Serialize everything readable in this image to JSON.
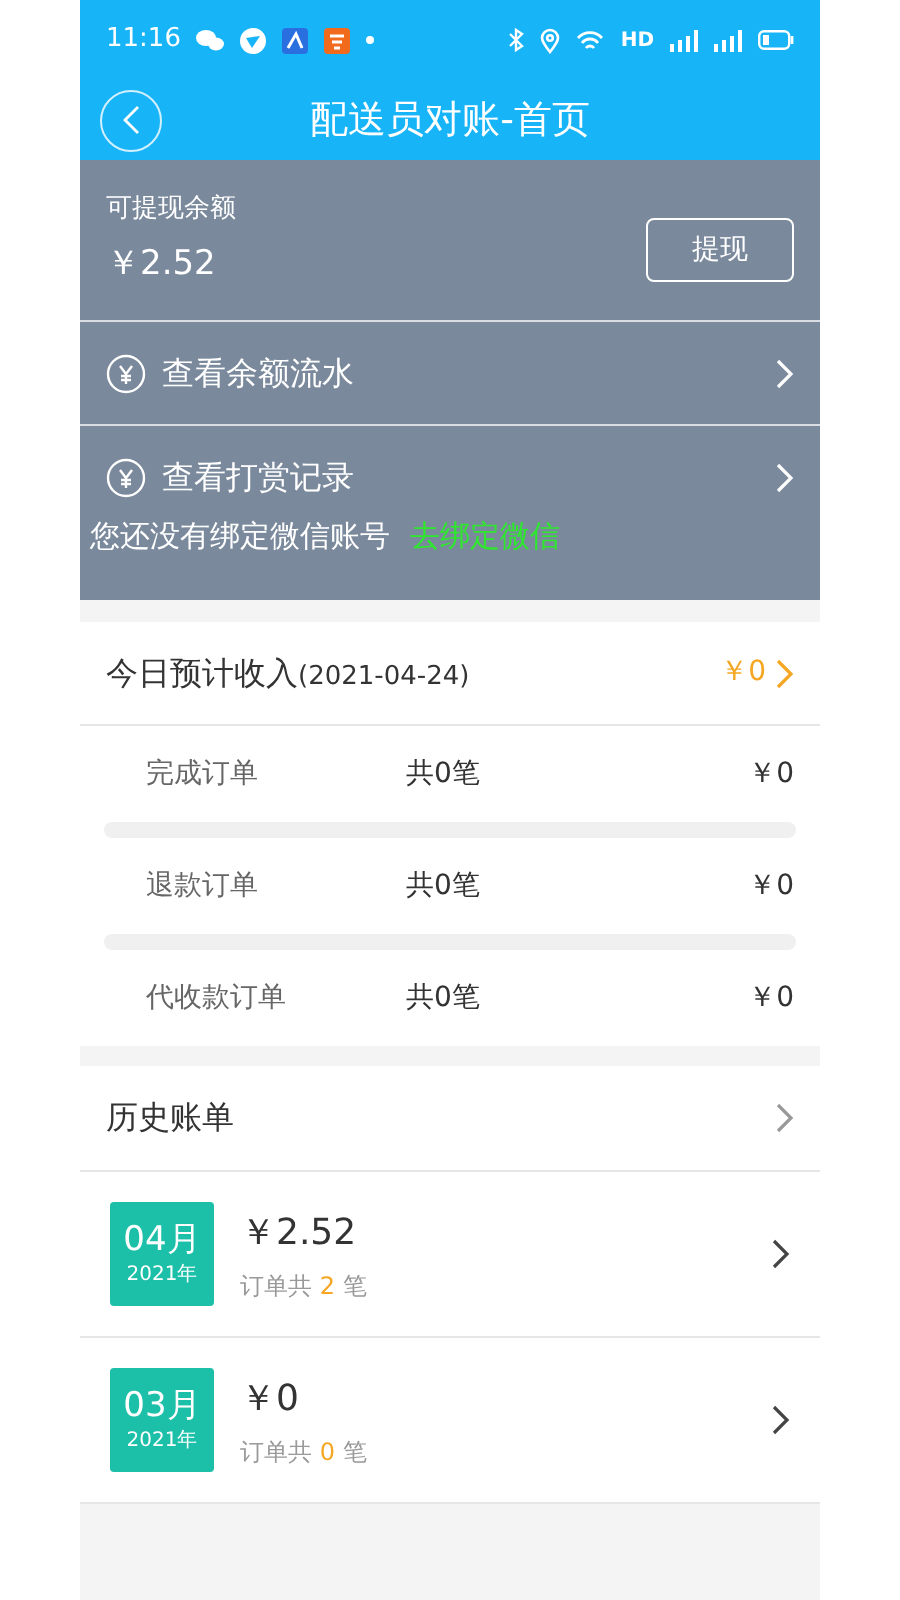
{
  "status_bar": {
    "time": "11:16",
    "network": "HD"
  },
  "header": {
    "title": "配送员对账-首页"
  },
  "balance": {
    "label": "可提现余额",
    "amount": "￥2.52",
    "withdraw_button": "提现"
  },
  "links": [
    {
      "label": "查看余额流水"
    },
    {
      "label": "查看打赏记录"
    }
  ],
  "wechat": {
    "notice": "您还没有绑定微信账号",
    "link": "去绑定微信"
  },
  "today": {
    "title": "今日预计收入",
    "date": "(2021-04-24)",
    "amount": "￥0",
    "rows": [
      {
        "label": "完成订单",
        "count": "共0笔",
        "amount": "￥0"
      },
      {
        "label": "退款订单",
        "count": "共0笔",
        "amount": "￥0"
      },
      {
        "label": "代收款订单",
        "count": "共0笔",
        "amount": "￥0"
      }
    ]
  },
  "history": {
    "title": "历史账单",
    "bills": [
      {
        "month": "04月",
        "year": "2021年",
        "amount": "￥2.52",
        "count_prefix": "订单共",
        "count": "2",
        "count_suffix": "笔"
      },
      {
        "month": "03月",
        "year": "2021年",
        "amount": "￥0",
        "count_prefix": "订单共",
        "count": "0",
        "count_suffix": "笔"
      }
    ]
  }
}
